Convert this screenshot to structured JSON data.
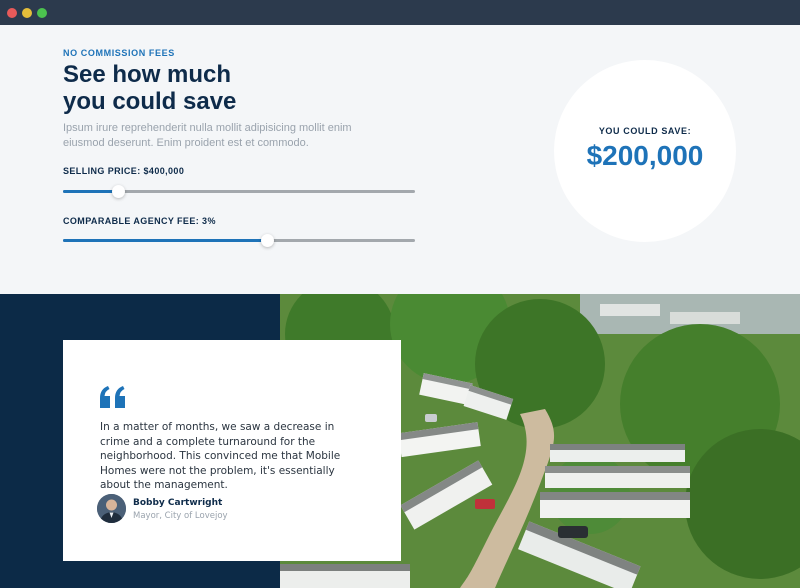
{
  "window": {
    "controls": [
      "close-dot",
      "minimize-dot",
      "maximize-dot"
    ]
  },
  "calculator": {
    "eyebrow": "NO COMMISSION FEES",
    "headline_line1": "See how much",
    "headline_line2": "you could save",
    "intro": "Ipsum irure reprehenderit nulla mollit adipisicing mollit enim eiusmod deserunt. Enim proident est et commodo.",
    "selling_price": {
      "label": "SELLING PRICE: $400,000",
      "fill_fraction": 0.155
    },
    "agency_fee": {
      "label": "COMPARABLE AGENCY FEE: 3%",
      "fill_fraction": 0.58
    },
    "savings": {
      "label": "YOU COULD SAVE:",
      "value": "$200,000"
    }
  },
  "testimonial": {
    "quote": "In a matter of months, we saw a decrease in crime and a complete turnaround for the neighborhood. This convinced me that Mobile Homes were not the problem, it's essentially about the management.",
    "author_name": "Bobby Cartwright",
    "author_title": "Mayor, City of Lovejoy"
  },
  "colors": {
    "accent": "#1e73b8",
    "navy": "#0e2b4a",
    "dark_section": "#0c2a47",
    "muted_text": "#9aa3ad",
    "panel_bg": "#f4f6f8"
  }
}
